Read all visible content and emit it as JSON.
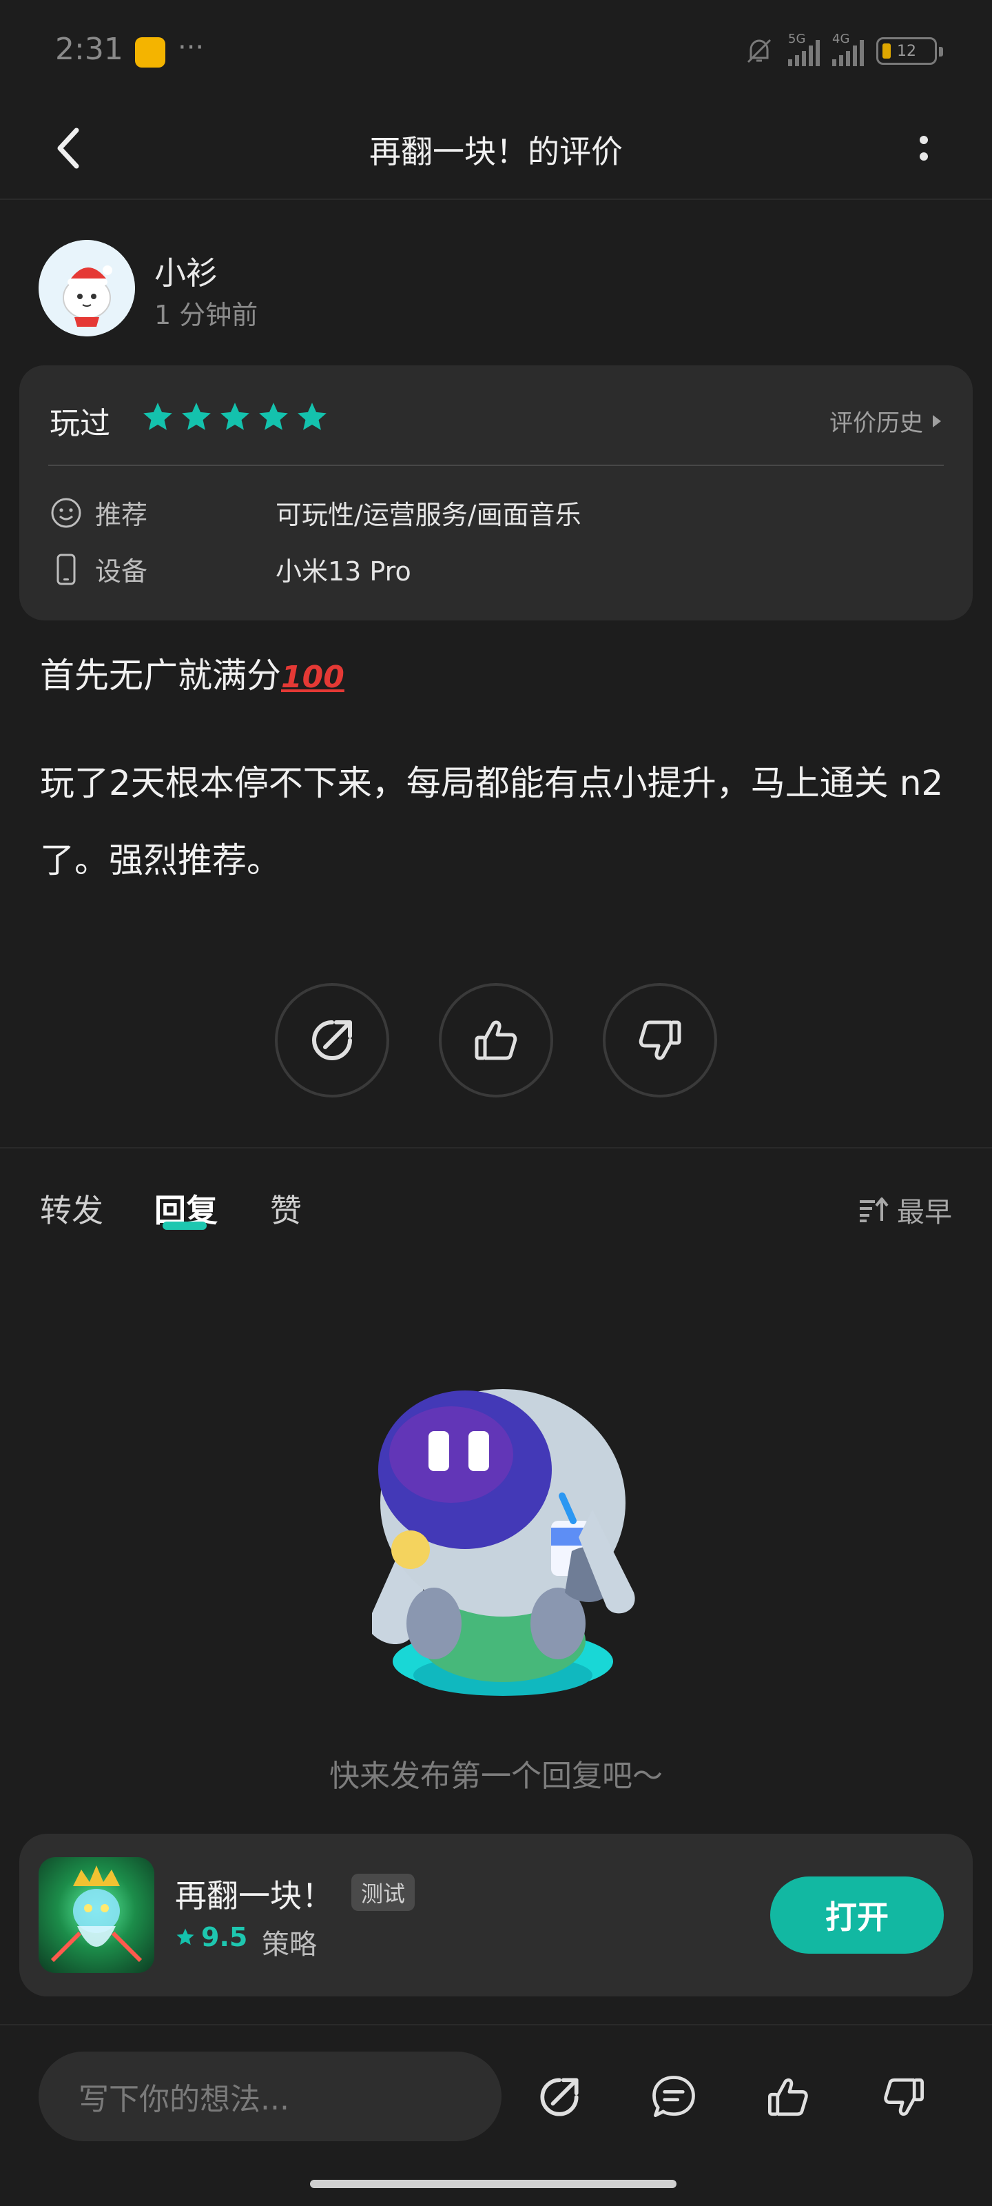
{
  "status_bar": {
    "time": "2:31",
    "more": "···",
    "net1": "5G",
    "net2": "4G",
    "battery": "12"
  },
  "header": {
    "title": "再翻一块！的评价"
  },
  "user": {
    "name": "小衫",
    "time": "1 分钟前"
  },
  "review_card": {
    "played_label": "玩过",
    "stars": 5,
    "history_label": "评价历史",
    "recommend_label": "推荐",
    "recommend_value": "可玩性/运营服务/画面音乐",
    "device_label": "设备",
    "device_value": "小米13 Pro"
  },
  "review": {
    "line1": "首先无广就满分",
    "emoji": "100",
    "line2": "玩了2天根本停不下来，每局都能有点小提升，马上通关 n2了。强烈推荐。"
  },
  "tabs": {
    "repost": "转发",
    "reply": "回复",
    "like": "赞",
    "sort": "最早"
  },
  "empty_text": "快来发布第一个回复吧～",
  "game": {
    "name": "再翻一块！",
    "tag": "测试",
    "rating": "9.5",
    "category": "策略",
    "open_label": "打开"
  },
  "bottom": {
    "input_placeholder": "写下你的想法..."
  },
  "colors": {
    "accent": "#12b8a2",
    "star": "#14c2ad"
  }
}
